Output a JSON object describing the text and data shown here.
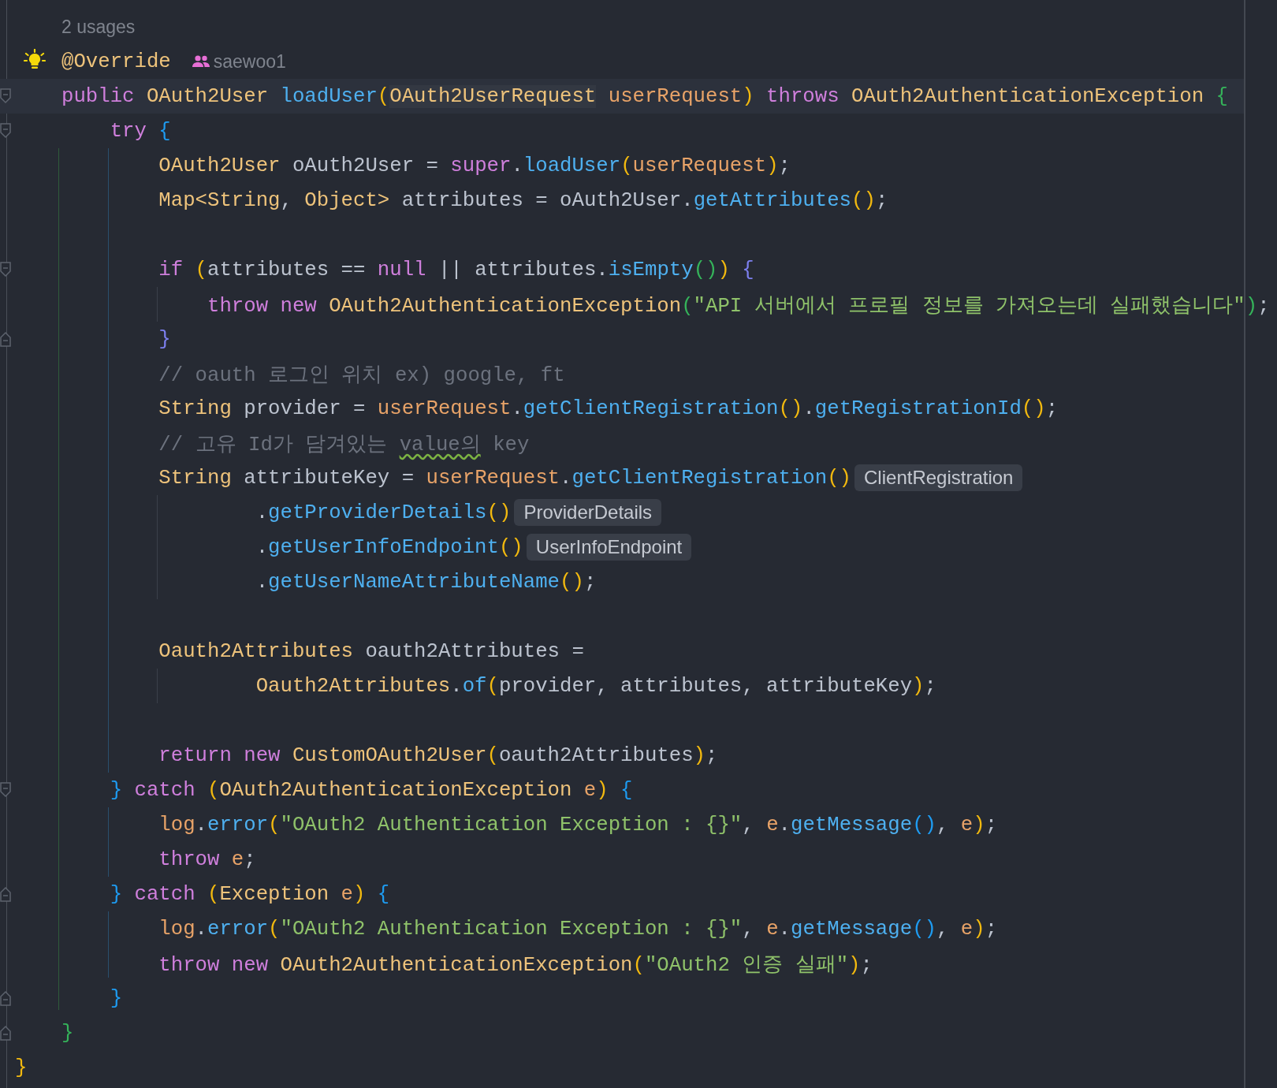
{
  "lines": [
    {
      "kind": "usages",
      "text": "2 usages"
    },
    {
      "kind": "code",
      "gutter_icon": {
        "kind": "bulb"
      },
      "tokens": [
        {
          "text": "@Override",
          "kind": "type"
        }
      ],
      "author": "saewoo1"
    },
    {
      "kind": "code",
      "current": true,
      "fold": {
        "kind": "start"
      },
      "tokens": [
        {
          "text": "public ",
          "kind": "kw"
        },
        {
          "text": "OAuth2User ",
          "kind": "type"
        },
        {
          "text": "loadUser",
          "kind": "fn"
        },
        {
          "text": "(",
          "kind": "b1"
        },
        {
          "text": "OAuth2UserRequest",
          "kind": "hl"
        },
        {
          "text": " userRequest",
          "kind": "param"
        },
        {
          "text": ")",
          "kind": "b1"
        },
        {
          "text": " throws ",
          "kind": "kw"
        },
        {
          "text": "OAuth2AuthenticationException ",
          "kind": "type"
        },
        {
          "text": "{",
          "kind": "b3"
        }
      ]
    },
    {
      "kind": "code",
      "fold": {
        "kind": "start"
      },
      "tokens": [
        {
          "text": "    try ",
          "kind": "kw"
        },
        {
          "text": "{",
          "kind": "b2"
        }
      ]
    },
    {
      "kind": "code",
      "tokens": [
        {
          "text": "        OAuth2User ",
          "kind": "type"
        },
        {
          "text": "oAuth2User = ",
          "kind": "plain"
        },
        {
          "text": "super",
          "kind": "kw"
        },
        {
          "text": ".",
          "kind": "plain"
        },
        {
          "text": "loadUser",
          "kind": "fn"
        },
        {
          "text": "(",
          "kind": "b1"
        },
        {
          "text": "userRequest",
          "kind": "param"
        },
        {
          "text": ")",
          "kind": "b1"
        },
        {
          "text": ";",
          "kind": "plain"
        }
      ]
    },
    {
      "kind": "code",
      "tokens": [
        {
          "text": "        Map<String",
          "kind": "type"
        },
        {
          "text": ", ",
          "kind": "plain"
        },
        {
          "text": "Object> ",
          "kind": "type"
        },
        {
          "text": "attributes = oAuth2User.",
          "kind": "plain"
        },
        {
          "text": "getAttributes",
          "kind": "fn"
        },
        {
          "text": "()",
          "kind": "b1"
        },
        {
          "text": ";",
          "kind": "plain"
        }
      ]
    },
    {
      "kind": "blank"
    },
    {
      "kind": "code",
      "fold": {
        "kind": "start"
      },
      "tokens": [
        {
          "text": "        if ",
          "kind": "kw"
        },
        {
          "text": "(",
          "kind": "b1"
        },
        {
          "text": "attributes == ",
          "kind": "plain"
        },
        {
          "text": "null",
          "kind": "kw"
        },
        {
          "text": " || attributes.",
          "kind": "plain"
        },
        {
          "text": "isEmpty",
          "kind": "fn"
        },
        {
          "text": "()",
          "kind": "b3"
        },
        {
          "text": ")",
          "kind": "b1"
        },
        {
          "text": " {",
          "kind": "b4"
        }
      ]
    },
    {
      "kind": "code",
      "tokens": [
        {
          "text": "            throw new ",
          "kind": "kw"
        },
        {
          "text": "OAuth2AuthenticationException",
          "kind": "type"
        },
        {
          "text": "(",
          "kind": "b3"
        },
        {
          "text": "\"API 서버에서 프로필 정보를 가져오는데 실패했습니다\"",
          "kind": "str"
        },
        {
          "text": ")",
          "kind": "b3"
        },
        {
          "text": ";",
          "kind": "plain"
        }
      ]
    },
    {
      "kind": "code",
      "fold": {
        "kind": "end"
      },
      "tokens": [
        {
          "text": "        }",
          "kind": "b4"
        }
      ]
    },
    {
      "kind": "code",
      "tokens": [
        {
          "text": "        // oauth 로그인 위치 ex) google, ft",
          "kind": "comment"
        }
      ]
    },
    {
      "kind": "code",
      "tokens": [
        {
          "text": "        String ",
          "kind": "type"
        },
        {
          "text": "provider = ",
          "kind": "plain"
        },
        {
          "text": "userRequest",
          "kind": "param"
        },
        {
          "text": ".",
          "kind": "plain"
        },
        {
          "text": "getClientRegistration",
          "kind": "fn"
        },
        {
          "text": "()",
          "kind": "b1"
        },
        {
          "text": ".",
          "kind": "plain"
        },
        {
          "text": "getRegistrationId",
          "kind": "fn"
        },
        {
          "text": "()",
          "kind": "b1"
        },
        {
          "text": ";",
          "kind": "plain"
        }
      ]
    },
    {
      "kind": "code",
      "tokens": [
        {
          "text": "        // 고유 Id가 담겨있는 ",
          "kind": "comment"
        },
        {
          "text": "value의",
          "kind": "warn"
        },
        {
          "text": " key",
          "kind": "comment"
        }
      ]
    },
    {
      "kind": "code",
      "tokens": [
        {
          "text": "        String ",
          "kind": "type"
        },
        {
          "text": "attributeKey = ",
          "kind": "plain"
        },
        {
          "text": "userRequest",
          "kind": "param"
        },
        {
          "text": ".",
          "kind": "plain"
        },
        {
          "text": "getClientRegistration",
          "kind": "fn"
        },
        {
          "text": "()",
          "kind": "b1"
        }
      ],
      "hint": "ClientRegistration"
    },
    {
      "kind": "code",
      "tokens": [
        {
          "text": "                .",
          "kind": "plain"
        },
        {
          "text": "getProviderDetails",
          "kind": "fn"
        },
        {
          "text": "()",
          "kind": "b1"
        }
      ],
      "hint": "ProviderDetails"
    },
    {
      "kind": "code",
      "tokens": [
        {
          "text": "                .",
          "kind": "plain"
        },
        {
          "text": "getUserInfoEndpoint",
          "kind": "fn"
        },
        {
          "text": "()",
          "kind": "b1"
        }
      ],
      "hint": "UserInfoEndpoint"
    },
    {
      "kind": "code",
      "tokens": [
        {
          "text": "                .",
          "kind": "plain"
        },
        {
          "text": "getUserNameAttributeName",
          "kind": "fn"
        },
        {
          "text": "()",
          "kind": "b1"
        },
        {
          "text": ";",
          "kind": "plain"
        }
      ]
    },
    {
      "kind": "blank"
    },
    {
      "kind": "code",
      "tokens": [
        {
          "text": "        Oauth2Attributes ",
          "kind": "type"
        },
        {
          "text": "oauth2Attributes =",
          "kind": "plain"
        }
      ]
    },
    {
      "kind": "code",
      "tokens": [
        {
          "text": "                Oauth2Attributes",
          "kind": "type"
        },
        {
          "text": ".",
          "kind": "plain"
        },
        {
          "text": "of",
          "kind": "fn"
        },
        {
          "text": "(",
          "kind": "b1"
        },
        {
          "text": "provider, attributes, attributeKey",
          "kind": "plain"
        },
        {
          "text": ")",
          "kind": "b1"
        },
        {
          "text": ";",
          "kind": "plain"
        }
      ]
    },
    {
      "kind": "blank"
    },
    {
      "kind": "code",
      "tokens": [
        {
          "text": "        return new ",
          "kind": "kw"
        },
        {
          "text": "CustomOAuth2User",
          "kind": "type"
        },
        {
          "text": "(",
          "kind": "b1"
        },
        {
          "text": "oauth2Attributes",
          "kind": "plain"
        },
        {
          "text": ")",
          "kind": "b1"
        },
        {
          "text": ";",
          "kind": "plain"
        }
      ]
    },
    {
      "kind": "code",
      "fold": {
        "kind": "start"
      },
      "tokens": [
        {
          "text": "    }",
          "kind": "b2"
        },
        {
          "text": " catch ",
          "kind": "kw"
        },
        {
          "text": "(",
          "kind": "b1"
        },
        {
          "text": "OAuth2AuthenticationException ",
          "kind": "type"
        },
        {
          "text": "e",
          "kind": "param"
        },
        {
          "text": ")",
          "kind": "b1"
        },
        {
          "text": " {",
          "kind": "b2"
        }
      ]
    },
    {
      "kind": "code",
      "tokens": [
        {
          "text": "        log",
          "kind": "param"
        },
        {
          "text": ".",
          "kind": "plain"
        },
        {
          "text": "error",
          "kind": "fn"
        },
        {
          "text": "(",
          "kind": "b1"
        },
        {
          "text": "\"OAuth2 Authentication Exception : {}\"",
          "kind": "str"
        },
        {
          "text": ", ",
          "kind": "plain"
        },
        {
          "text": "e",
          "kind": "param"
        },
        {
          "text": ".",
          "kind": "plain"
        },
        {
          "text": "getMessage",
          "kind": "fn"
        },
        {
          "text": "()",
          "kind": "b2"
        },
        {
          "text": ", ",
          "kind": "plain"
        },
        {
          "text": "e",
          "kind": "param"
        },
        {
          "text": ")",
          "kind": "b1"
        },
        {
          "text": ";",
          "kind": "plain"
        }
      ]
    },
    {
      "kind": "code",
      "tokens": [
        {
          "text": "        throw ",
          "kind": "kw"
        },
        {
          "text": "e",
          "kind": "param"
        },
        {
          "text": ";",
          "kind": "plain"
        }
      ]
    },
    {
      "kind": "code",
      "fold": {
        "kind": "end"
      },
      "tokens": [
        {
          "text": "    }",
          "kind": "b2"
        },
        {
          "text": " catch ",
          "kind": "kw"
        },
        {
          "text": "(",
          "kind": "b1"
        },
        {
          "text": "Exception ",
          "kind": "type"
        },
        {
          "text": "e",
          "kind": "param"
        },
        {
          "text": ")",
          "kind": "b1"
        },
        {
          "text": " {",
          "kind": "b2"
        }
      ]
    },
    {
      "kind": "code",
      "tokens": [
        {
          "text": "        log",
          "kind": "param"
        },
        {
          "text": ".",
          "kind": "plain"
        },
        {
          "text": "error",
          "kind": "fn"
        },
        {
          "text": "(",
          "kind": "b1"
        },
        {
          "text": "\"OAuth2 Authentication Exception : {}\"",
          "kind": "str"
        },
        {
          "text": ", ",
          "kind": "plain"
        },
        {
          "text": "e",
          "kind": "param"
        },
        {
          "text": ".",
          "kind": "plain"
        },
        {
          "text": "getMessage",
          "kind": "fn"
        },
        {
          "text": "()",
          "kind": "b2"
        },
        {
          "text": ", ",
          "kind": "plain"
        },
        {
          "text": "e",
          "kind": "param"
        },
        {
          "text": ")",
          "kind": "b1"
        },
        {
          "text": ";",
          "kind": "plain"
        }
      ]
    },
    {
      "kind": "code",
      "tokens": [
        {
          "text": "        throw new ",
          "kind": "kw"
        },
        {
          "text": "OAuth2AuthenticationException",
          "kind": "type"
        },
        {
          "text": "(",
          "kind": "b1"
        },
        {
          "text": "\"OAuth2 인증 실패\"",
          "kind": "str"
        },
        {
          "text": ")",
          "kind": "b1"
        },
        {
          "text": ";",
          "kind": "plain"
        }
      ]
    },
    {
      "kind": "code",
      "fold": {
        "kind": "end"
      },
      "tokens": [
        {
          "text": "    }",
          "kind": "b2"
        }
      ]
    },
    {
      "kind": "code",
      "fold": {
        "kind": "end"
      },
      "tokens": [
        {
          "text": "}",
          "kind": "b3"
        }
      ]
    },
    {
      "kind": "outer",
      "tokens": [
        {
          "text": "}",
          "kind": "b1"
        }
      ]
    }
  ]
}
